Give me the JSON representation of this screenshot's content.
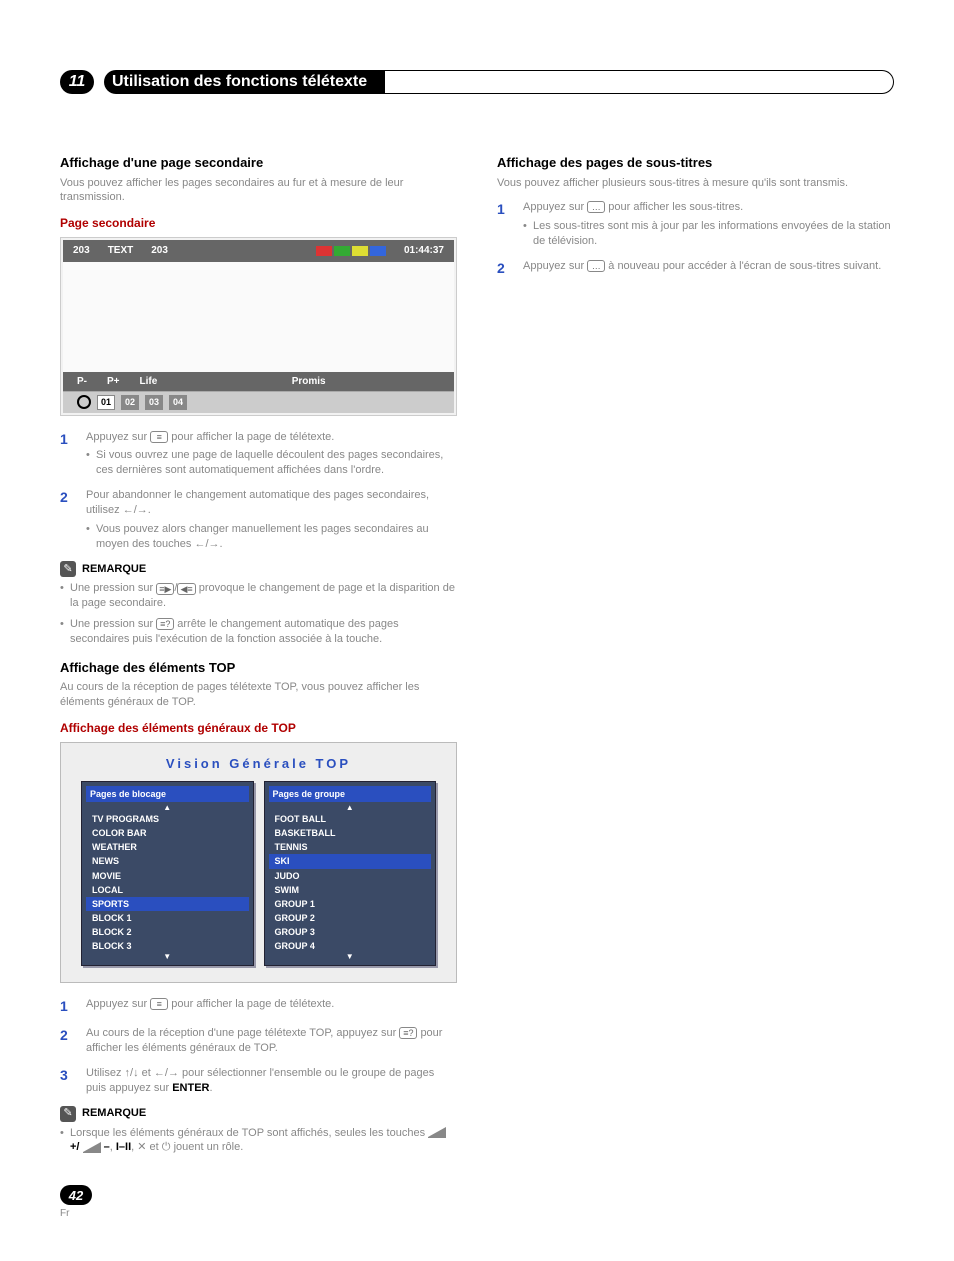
{
  "chapter": {
    "number": "11",
    "title": "Utilisation des fonctions télétexte"
  },
  "left": {
    "sec1_title": "Affichage d'une page secondaire",
    "sec1_intro": "Vous pouvez afficher les pages secondaires au fur et à mesure de leur transmission.",
    "sec1_sub": "Page secondaire",
    "teletext": {
      "h1": "203",
      "h2": "TEXT",
      "h3": "203",
      "time": "01:44:37",
      "f_pminus": "P-",
      "f_pplus": "P+",
      "f_life": "Life",
      "f_promis": "Promis",
      "c1": "01",
      "c2": "02",
      "c3": "03",
      "c4": "04"
    },
    "step1": "Appuyez sur ",
    "step1b": " pour afficher la page de télétexte.",
    "step1_sub": "Si vous ouvrez une page de laquelle découlent des pages secondaires, ces dernières sont automatiquement affichées dans l'ordre.",
    "step2a": "Pour abandonner le changement automatique des pages secondaires, utilisez ",
    "step2b": ".",
    "step2_sub_a": "Vous pouvez alors changer manuellement les pages secondaires au moyen des touches ",
    "step2_sub_b": ".",
    "remark_label": "REMARQUE",
    "remark1_a": "Une pression sur ",
    "remark1_b": " provoque le changement de page et la disparition de la page secondaire.",
    "remark2_a": "Une pression sur ",
    "remark2_b": " arrête le changement automatique des pages secondaires puis l'exécution de la fonction associée à la touche.",
    "sec2_title": "Affichage des éléments TOP",
    "sec2_intro": "Au cours de la réception de pages télétexte TOP, vous pouvez afficher les éléments généraux de TOP.",
    "sec2_sub": "Affichage des éléments généraux de TOP",
    "top_overview_title": "Vision Générale TOP",
    "panel_left_head": "Pages de blocage",
    "panel_left_items": [
      "TV PROGRAMS",
      "COLOR BAR",
      "WEATHER",
      "NEWS",
      "MOVIE",
      "LOCAL",
      "SPORTS",
      "BLOCK 1",
      "BLOCK 2",
      "BLOCK 3"
    ],
    "panel_right_head": "Pages de groupe",
    "panel_right_items": [
      "FOOT BALL",
      "BASKETBALL",
      "TENNIS",
      "SKI",
      "JUDO",
      "SWIM",
      "GROUP 1",
      "GROUP 2",
      "GROUP 3",
      "GROUP 4"
    ],
    "top_step1a": "Appuyez sur ",
    "top_step1b": " pour afficher la page de télétexte.",
    "top_step2a": "Au cours de la réception d'une page télétexte TOP, appuyez sur ",
    "top_step2b": " pour afficher les éléments généraux de TOP.",
    "top_step3a": "Utilisez ",
    "top_step3b": " et ",
    "top_step3c": " pour sélectionner l'ensemble ou le groupe de pages puis appuyez sur ",
    "top_step3_enter": "ENTER",
    "top_step3d": ".",
    "remark3_a": "Lorsque les éléments généraux de TOP sont affichés, seules les touches ",
    "remark3_b": " jouent un rôle."
  },
  "right": {
    "sec_title": "Affichage des pages de sous-titres",
    "sec_intro": "Vous pouvez afficher plusieurs sous-titres à mesure qu'ils sont transmis.",
    "step1a": "Appuyez sur ",
    "step1b": " pour afficher les sous-titres.",
    "step1_sub": "Les sous-titres sont mis à jour par les informations envoyées de la station de télévision.",
    "step2a": "Appuyez sur ",
    "step2b": " à nouveau pour accéder à l'écran de sous-titres suivant."
  },
  "icons": {
    "teletext": "≡",
    "subtitle": "…",
    "sub_page_l": "◀≡",
    "sub_page_r": "≡▶",
    "hold": "≡?",
    "left": "←",
    "right": "→",
    "up": "↑",
    "down": "↓",
    "mute": "✕",
    "power": "⏻",
    "plus": "+/",
    "minus": "–",
    "ii": "I–II"
  },
  "footer": {
    "page": "42",
    "lang": "Fr"
  }
}
